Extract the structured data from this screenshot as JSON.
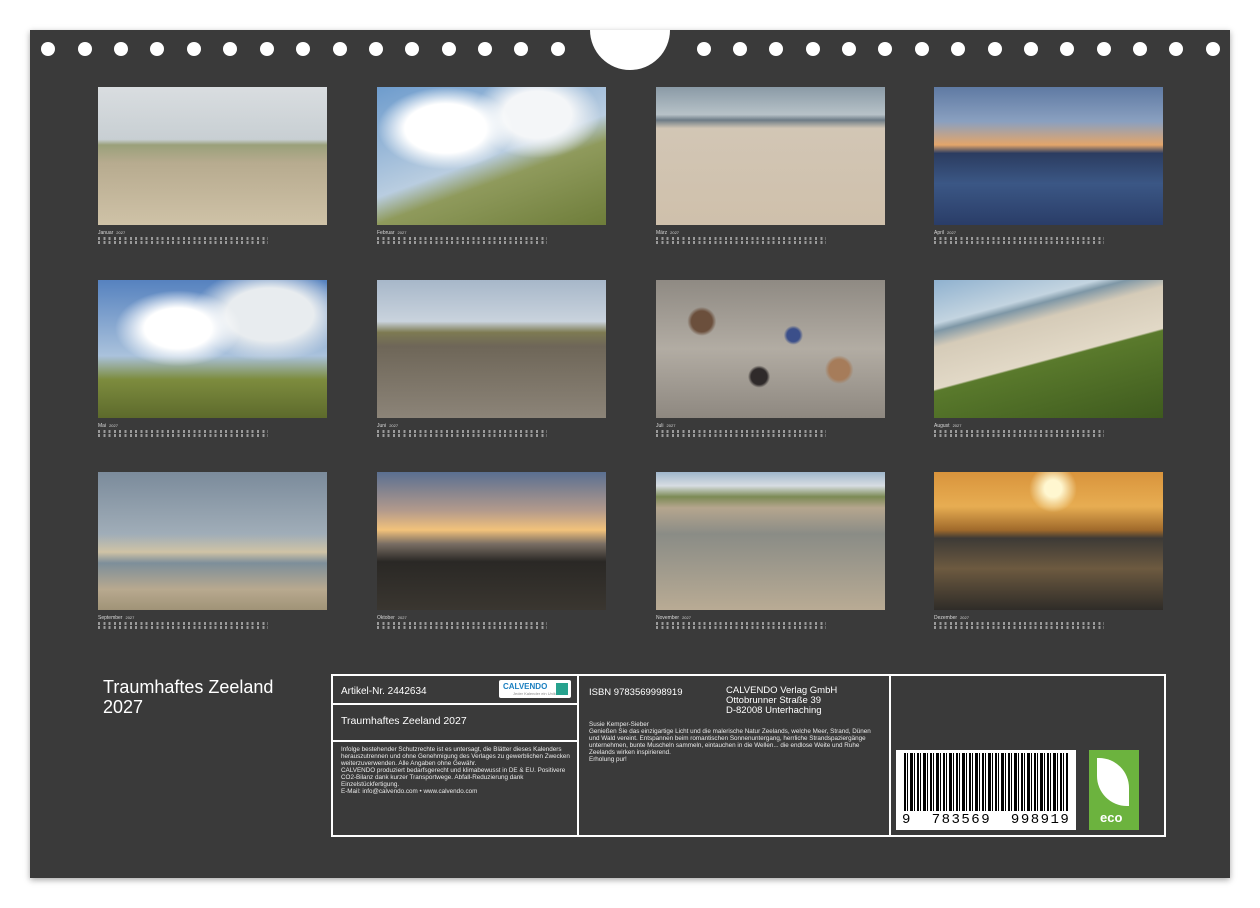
{
  "year": "2027",
  "months": [
    {
      "name": "Januar",
      "photo": "dunes-groynes"
    },
    {
      "name": "Februar",
      "photo": "dune-clouds"
    },
    {
      "name": "März",
      "photo": "wooden-posts"
    },
    {
      "name": "April",
      "photo": "sunset-beach"
    },
    {
      "name": "Mai",
      "photo": "dune-clouds-2"
    },
    {
      "name": "Juni",
      "photo": "groyne-row"
    },
    {
      "name": "Juli",
      "photo": "shells"
    },
    {
      "name": "August",
      "photo": "beach-huts"
    },
    {
      "name": "September",
      "photo": "groynes-sea"
    },
    {
      "name": "Oktober",
      "photo": "sunset-walkers"
    },
    {
      "name": "November",
      "photo": "groyne-posts-dune"
    },
    {
      "name": "Dezember",
      "photo": "golden-sunset"
    }
  ],
  "title": "Traumhaftes Zeeland\n2027",
  "info": {
    "article": "Artikel-Nr. 2442634",
    "calvendo_logo": "CALVENDO",
    "calvendo_sub": "Jeder Kalender ein Unikat",
    "product_title": "Traumhaftes Zeeland 2027",
    "legal": "Infolge bestehender Schutzrechte ist es untersagt, die Blätter dieses Kalenders herauszutrennen und ohne Genehmigung des Verlages zu gewerblichen Zwecken weiterzuverwenden. Alle Angaben ohne Gewähr.\nCALVENDO produziert bedarfsgerecht und klimabewusst in DE & EU. Positivere CO2-Bilanz dank kurzer Transportwege. Abfall-Reduzierung dank Einzelstückfertigung.\nE-Mail: info@calvendo.com • www.calvendo.com",
    "isbn": "ISBN 9783569998919",
    "publisher": "CALVENDO Verlag GmbH\nOttobrunner Straße 39\nD-82008 Unterhaching",
    "author": "Susie Kemper-Sieber",
    "description": "Genießen Sie das einzigartige Licht und die malerische Natur Zeelands, welche Meer, Strand, Dünen und Wald vereint. Entspannen beim romantischen Sonnenuntergang, herrliche Strandspaziergänge unternehmen, bunte Muscheln sammeln, eintauchen in die Wellen... die endlose Weite und Ruhe Zeelands wirken inspirierend.\nErholung pur!",
    "barcode_digits": "9  783569  998919",
    "eco_label": "eco"
  }
}
